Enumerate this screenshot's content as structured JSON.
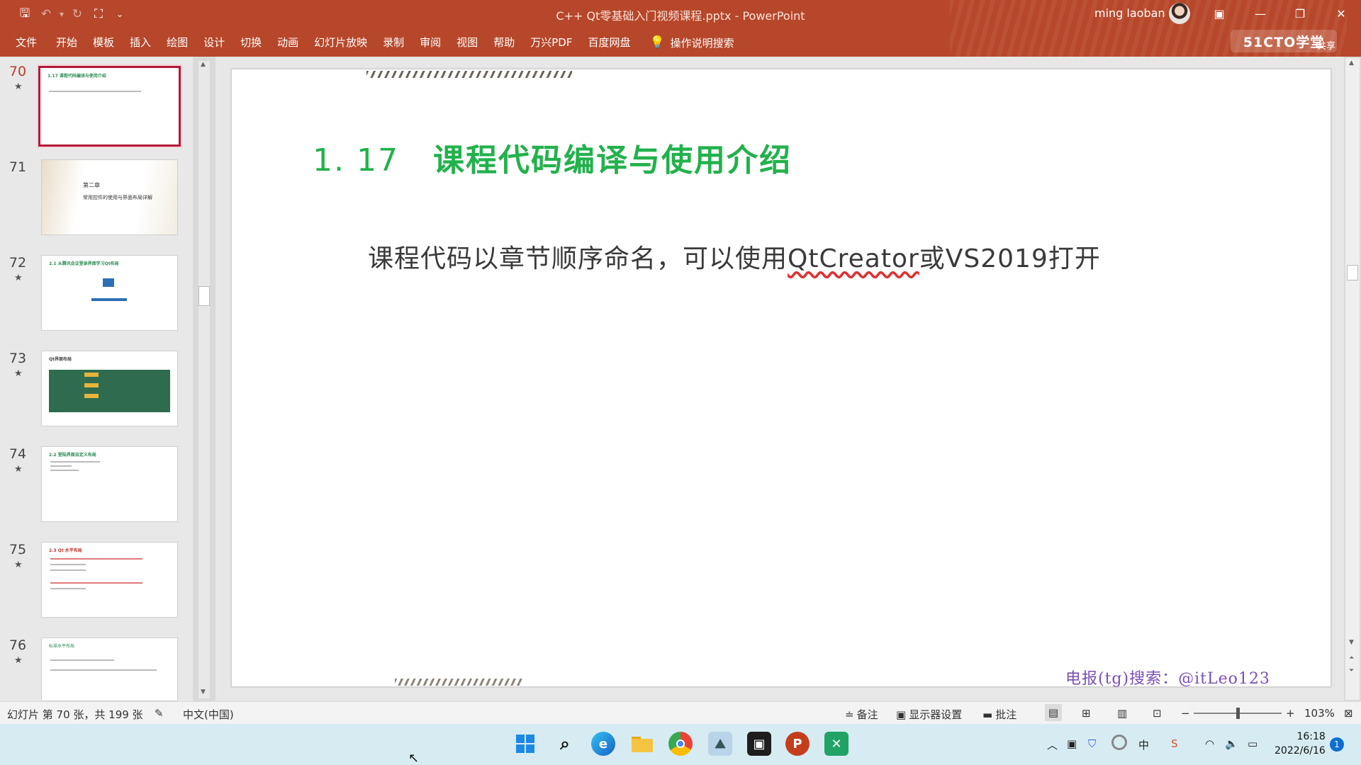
{
  "window": {
    "title": "C++ Qt零基础入门视频课程.pptx  -  PowerPoint",
    "user": "ming laoban",
    "brand_logo": "51CTO学堂",
    "share_label": "共享"
  },
  "ribbon": {
    "tabs": [
      "文件",
      "开始",
      "模板",
      "插入",
      "绘图",
      "设计",
      "切换",
      "动画",
      "幻灯片放映",
      "录制",
      "审阅",
      "视图",
      "帮助",
      "万兴PDF",
      "百度网盘"
    ],
    "tell_me": "操作说明搜索"
  },
  "thumbnails": [
    {
      "number": "70",
      "title": "1.17  课程代码编译与使用介绍",
      "selected": true
    },
    {
      "number": "71",
      "title": "第二章",
      "subtitle": "常用控件的使用与界面布局详解"
    },
    {
      "number": "72",
      "title": "2.1 从腾讯会议登录界面学习Qt布局"
    },
    {
      "number": "73",
      "title": "Qt界面布局"
    },
    {
      "number": "74",
      "title": "2.2 登陆界面自定义布局"
    },
    {
      "number": "75",
      "title": "2.3 Qt 水平布局"
    },
    {
      "number": "76",
      "title": "标准水平布局"
    }
  ],
  "slide": {
    "title_num": "1. 17",
    "title_text": "课程代码编译与使用介绍",
    "body_prefix": "课程代码以章节顺序命名，可以使用",
    "body_qt": "QtCreator",
    "body_suffix": "或VS2019打开",
    "watermark": "电报(tg)搜索：@itLeo123"
  },
  "statusbar": {
    "slide_count": "幻灯片 第 70 张，共 199 张",
    "language": "中文(中国)",
    "notes": "备注",
    "display_settings": "显示器设置",
    "comments": "批注",
    "zoom": "103%"
  },
  "taskbar": {
    "time": "16:18",
    "date": "2022/6/16",
    "notifications": "1"
  },
  "colors": {
    "accent": "#b7472a",
    "title_green": "#22b14c",
    "watermark": "#7a4fb5"
  }
}
